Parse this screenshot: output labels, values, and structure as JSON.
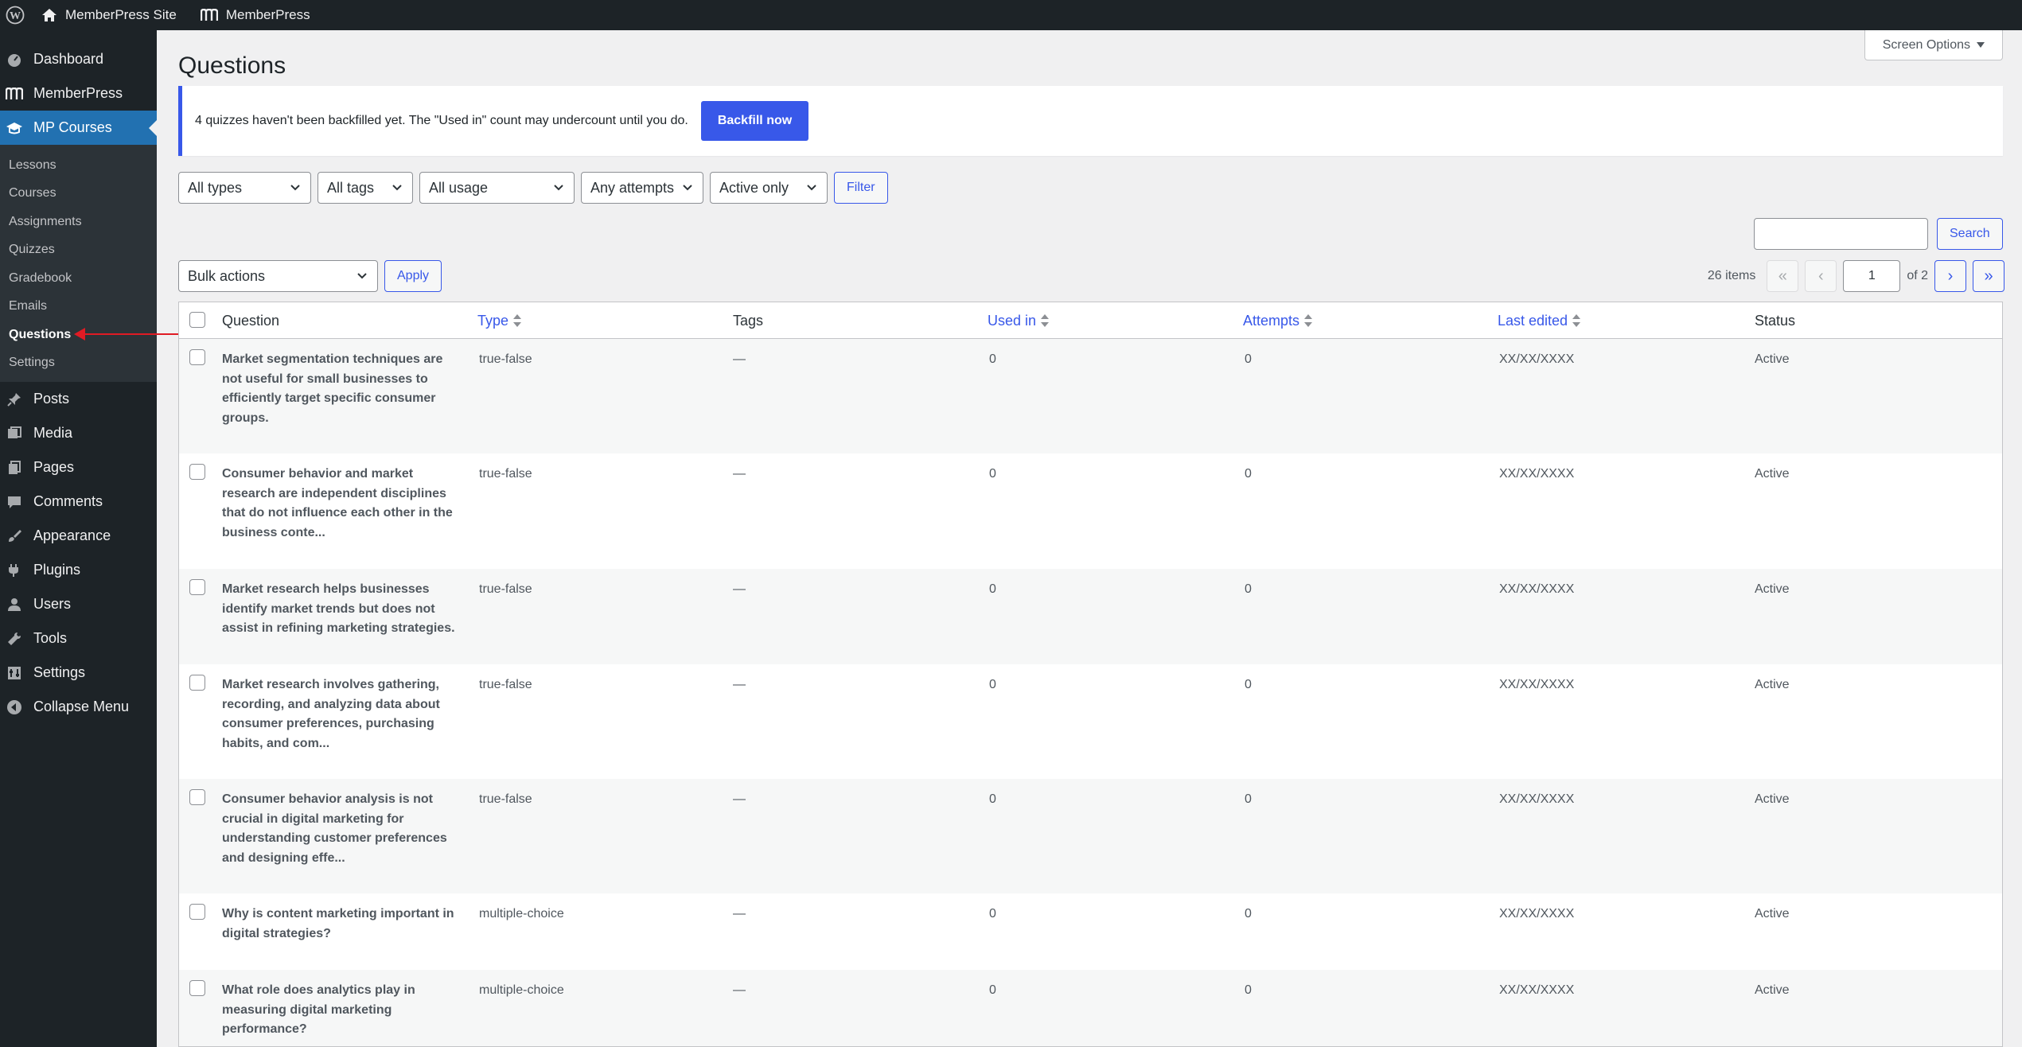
{
  "adminbar": {
    "site_name": "MemberPress Site",
    "plugin_name": "MemberPress"
  },
  "sidebar": {
    "top_items": [
      {
        "label": "Dashboard",
        "icon": "dashboard-icon"
      },
      {
        "label": "MemberPress",
        "icon": "memberpress-icon"
      },
      {
        "label": "MP Courses",
        "icon": "courses-icon"
      }
    ],
    "submenu": [
      "Lessons",
      "Courses",
      "Assignments",
      "Quizzes",
      "Gradebook",
      "Emails",
      "Questions",
      "Settings"
    ],
    "bottom_items": [
      {
        "label": "Posts",
        "icon": "pin-icon"
      },
      {
        "label": "Media",
        "icon": "media-icon"
      },
      {
        "label": "Pages",
        "icon": "pages-icon"
      },
      {
        "label": "Comments",
        "icon": "comment-icon"
      },
      {
        "label": "Appearance",
        "icon": "brush-icon"
      },
      {
        "label": "Plugins",
        "icon": "plug-icon"
      },
      {
        "label": "Users",
        "icon": "user-icon"
      },
      {
        "label": "Tools",
        "icon": "wrench-icon"
      },
      {
        "label": "Settings",
        "icon": "settings-icon"
      },
      {
        "label": "Collapse Menu",
        "icon": "collapse-icon"
      }
    ]
  },
  "header": {
    "screen_options": "Screen Options",
    "title": "Questions"
  },
  "notice": {
    "text": "4 quizzes haven't been backfilled yet. The \"Used in\" count may undercount until you do.",
    "button": "Backfill now"
  },
  "filters": {
    "type": "All types",
    "tags": "All tags",
    "usage": "All usage",
    "attempts": "Any attempts",
    "status": "Active only",
    "button": "Filter"
  },
  "search": {
    "button": "Search",
    "placeholder": ""
  },
  "bulk": {
    "select": "Bulk actions",
    "apply": "Apply"
  },
  "pagination": {
    "items": "26 items",
    "first": "«",
    "prev": "‹",
    "current": "1",
    "of": "of 2",
    "next": "›",
    "last": "»"
  },
  "table": {
    "columns": {
      "question": "Question",
      "type": "Type",
      "tags": "Tags",
      "used_in": "Used in",
      "attempts": "Attempts",
      "last_edited": "Last edited",
      "status": "Status"
    },
    "rows": [
      {
        "question": "Market segmentation techniques are not useful for small businesses to efficiently target specific consumer groups.",
        "type": "true-false",
        "tags": "—",
        "used_in": "0",
        "attempts": "0",
        "last_edited": "XX/XX/XXXX",
        "status": "Active"
      },
      {
        "question": "Consumer behavior and market research are independent disciplines that do not influence each other in the business conte...",
        "type": "true-false",
        "tags": "—",
        "used_in": "0",
        "attempts": "0",
        "last_edited": "XX/XX/XXXX",
        "status": "Active"
      },
      {
        "question": "Market research helps businesses identify market trends but does not assist in refining marketing strategies.",
        "type": "true-false",
        "tags": "—",
        "used_in": "0",
        "attempts": "0",
        "last_edited": "XX/XX/XXXX",
        "status": "Active"
      },
      {
        "question": "Market research involves gathering, recording, and analyzing data about consumer preferences, purchasing habits, and com...",
        "type": "true-false",
        "tags": "—",
        "used_in": "0",
        "attempts": "0",
        "last_edited": "XX/XX/XXXX",
        "status": "Active"
      },
      {
        "question": "Consumer behavior analysis is not crucial in digital marketing for understanding customer preferences and designing effe...",
        "type": "true-false",
        "tags": "—",
        "used_in": "0",
        "attempts": "0",
        "last_edited": "XX/XX/XXXX",
        "status": "Active"
      },
      {
        "question": "Why is content marketing important in digital strategies?",
        "type": "multiple-choice",
        "tags": "—",
        "used_in": "0",
        "attempts": "0",
        "last_edited": "XX/XX/XXXX",
        "status": "Active"
      },
      {
        "question": "What role does analytics play in measuring digital marketing performance?",
        "type": "multiple-choice",
        "tags": "—",
        "used_in": "0",
        "attempts": "0",
        "last_edited": "XX/XX/XXXX",
        "status": "Active"
      }
    ]
  },
  "colors": {
    "accent": "#3858e9",
    "sidebar_bg": "#1d2327",
    "menu_current": "#2271b1",
    "annotation": "#e01b24"
  }
}
